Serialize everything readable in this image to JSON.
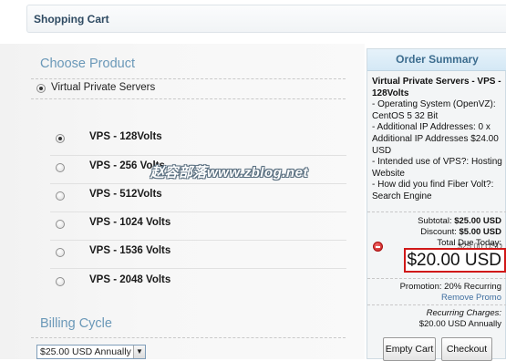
{
  "header": {
    "title": "Shopping Cart"
  },
  "choose_product": {
    "title": "Choose Product",
    "category": "Virtual Private Servers",
    "products": [
      {
        "label": "VPS - 128Volts",
        "checked": true
      },
      {
        "label": "VPS - 256 Volts",
        "checked": false
      },
      {
        "label": "VPS - 512Volts",
        "checked": false
      },
      {
        "label": "VPS - 1024 Volts",
        "checked": false
      },
      {
        "label": "VPS - 1536 Volts",
        "checked": false
      },
      {
        "label": "VPS - 2048 Volts",
        "checked": false
      }
    ]
  },
  "billing": {
    "title": "Billing Cycle",
    "selected": "$25.00 USD Annually"
  },
  "summary": {
    "title": "Order Summary",
    "product_name": "Virtual Private Servers - VPS - 128Volts",
    "details": [
      "- Operating System (OpenVZ): CentOS 5 32 Bit",
      "- Additional IP Addresses: 0 x Additional IP Addresses $24.00 USD",
      "- Intended use of VPS?: Hosting Website",
      "- How did you find Fiber Volt?: Search Engine"
    ],
    "item_price": "$25.00 USD",
    "subtotal_label": "Subtotal:",
    "subtotal": "$25.00 USD",
    "discount_label": "Discount:",
    "discount": "$5.00 USD",
    "total_label": "Total Due Today:",
    "total": "$20.00 USD",
    "promotion": "Promotion: 20% Recurring",
    "remove_promo": "Remove Promo",
    "recurring_label": "Recurring Charges:",
    "recurring_value": "$20.00 USD Annually",
    "empty_cart": "Empty Cart",
    "checkout": "Checkout"
  },
  "watermark": "赵容部落www.zblog.net",
  "colors": {
    "accent": "#6a98b8",
    "total_border": "#d01818"
  }
}
